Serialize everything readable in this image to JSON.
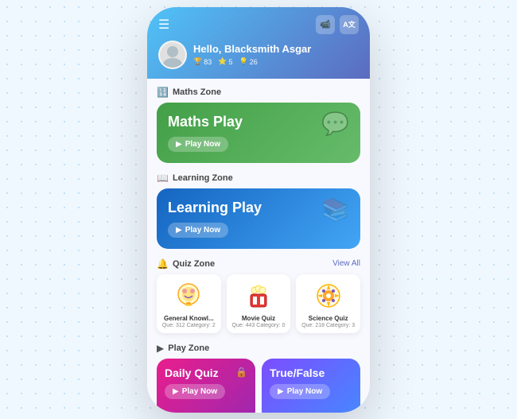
{
  "header": {
    "greeting": "Hello, Blacksmith Asgar",
    "menu_icon": "☰",
    "icon1": "🎬",
    "icon2": "A",
    "stats": [
      {
        "icon": "🏆",
        "value": "83"
      },
      {
        "icon": "⭐",
        "value": "5"
      },
      {
        "icon": "💡",
        "value": "26"
      }
    ]
  },
  "sections": {
    "maths": {
      "label": "Maths Zone",
      "icon": "123",
      "card": {
        "title": "Maths Play",
        "play_label": "Play Now"
      }
    },
    "learning": {
      "label": "Learning Zone",
      "icon": "📖",
      "card": {
        "title": "Learning Play",
        "play_label": "Play Now"
      }
    },
    "quiz": {
      "label": "Quiz Zone",
      "icon": "🔔",
      "view_all": "View All",
      "items": [
        {
          "name": "General Knowl...",
          "meta": "Que: 312  Category: 2",
          "emoji": "💡"
        },
        {
          "name": "Movie Quiz",
          "meta": "Que: 443  Category: 0",
          "emoji": "🍿"
        },
        {
          "name": "Science Quiz",
          "meta": "Que: 218  Category: 3",
          "emoji": "⚙️"
        }
      ]
    },
    "play_zone": {
      "label": "Play Zone",
      "icon": "▶",
      "cards": [
        {
          "title": "Daily Quiz",
          "subtitle": "Play Now",
          "has_lock": true
        },
        {
          "title": "True/False",
          "subtitle": "Play Now",
          "has_lock": false
        }
      ]
    }
  }
}
